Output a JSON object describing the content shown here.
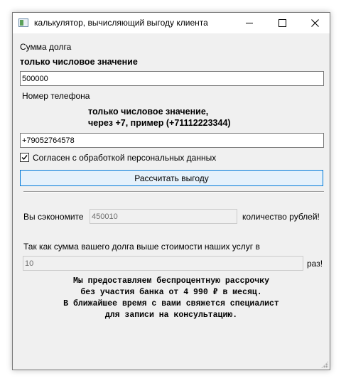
{
  "window": {
    "title": "калькулятор, вычисляющий выгоду клиента"
  },
  "form": {
    "debt_label": "Сумма долга",
    "debt_hint": "только числовое значение",
    "debt_value": "500000",
    "phone_label": "Номер телефона",
    "phone_hint_line1": "только числовое значение,",
    "phone_hint_line2": "через +7, пример (+71112223344)",
    "phone_value": "+79052764578",
    "consent_label": "Согласен с обработкой персональных данных",
    "consent_checked": true,
    "calculate_button": "Рассчитать выгоду"
  },
  "result": {
    "savings_prefix": "Вы сэкономите",
    "savings_value": "450010",
    "savings_suffix": "количество рублей!",
    "ratio_text": "Так как сумма вашего долга выше стоимости наших услуг в",
    "ratio_value": "10",
    "ratio_suffix": "раз!",
    "offer_lines": [
      "Мы предоставляем беспроцентную рассрочку",
      "без участия банка от 4 990 ₽ в месяц.",
      "В ближайшее время с вами свяжется специалист",
      "для записи на консультацию."
    ]
  }
}
